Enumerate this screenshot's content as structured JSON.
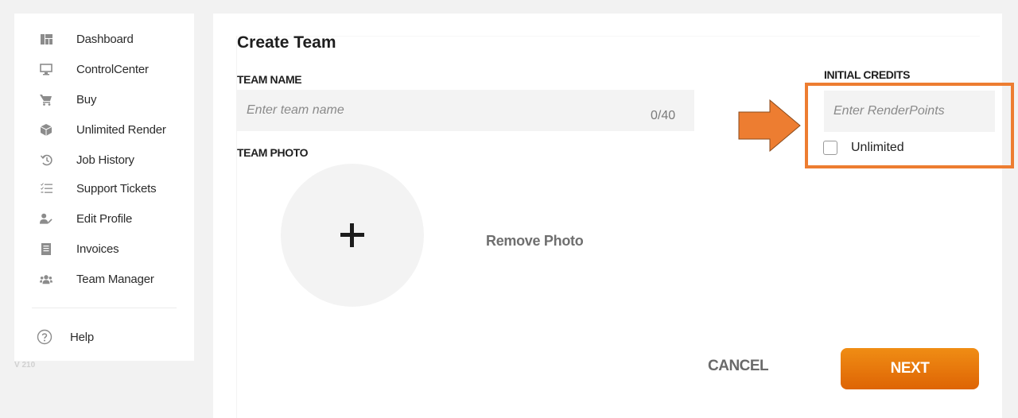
{
  "sidebar": {
    "items": [
      {
        "label": "Dashboard",
        "icon": "dashboard-icon"
      },
      {
        "label": "ControlCenter",
        "icon": "monitor-icon"
      },
      {
        "label": "Buy",
        "icon": "cart-icon"
      },
      {
        "label": "Unlimited Render",
        "icon": "cube-icon"
      },
      {
        "label": "Job History",
        "icon": "history-icon"
      },
      {
        "label": "Support Tickets",
        "icon": "checklist-icon"
      },
      {
        "label": "Edit Profile",
        "icon": "user-edit-icon"
      },
      {
        "label": "Invoices",
        "icon": "receipt-icon"
      },
      {
        "label": "Team Manager",
        "icon": "team-icon"
      }
    ],
    "help": {
      "label": "Help",
      "icon": "help-circle-icon"
    },
    "version": "V 210"
  },
  "main": {
    "title": "Create Team",
    "team_name": {
      "label": "TEAM NAME",
      "placeholder": "Enter team name",
      "value": "",
      "counter": "0/40"
    },
    "team_photo": {
      "label": "TEAM PHOTO",
      "add_icon": "plus-icon",
      "remove_label": "Remove Photo"
    },
    "initial_credits": {
      "label": "INITIAL CREDITS",
      "placeholder": "Enter RenderPoints",
      "value": "",
      "unlimited_label": "Unlimited",
      "unlimited_checked": false
    },
    "actions": {
      "cancel_label": "CANCEL",
      "next_label": "NEXT"
    }
  },
  "annotation": {
    "color": "#ed7d31",
    "target": "initial-credits"
  },
  "colors": {
    "accent": "#e97610",
    "background": "#f2f2f2",
    "input_background": "#f3f3f3"
  }
}
